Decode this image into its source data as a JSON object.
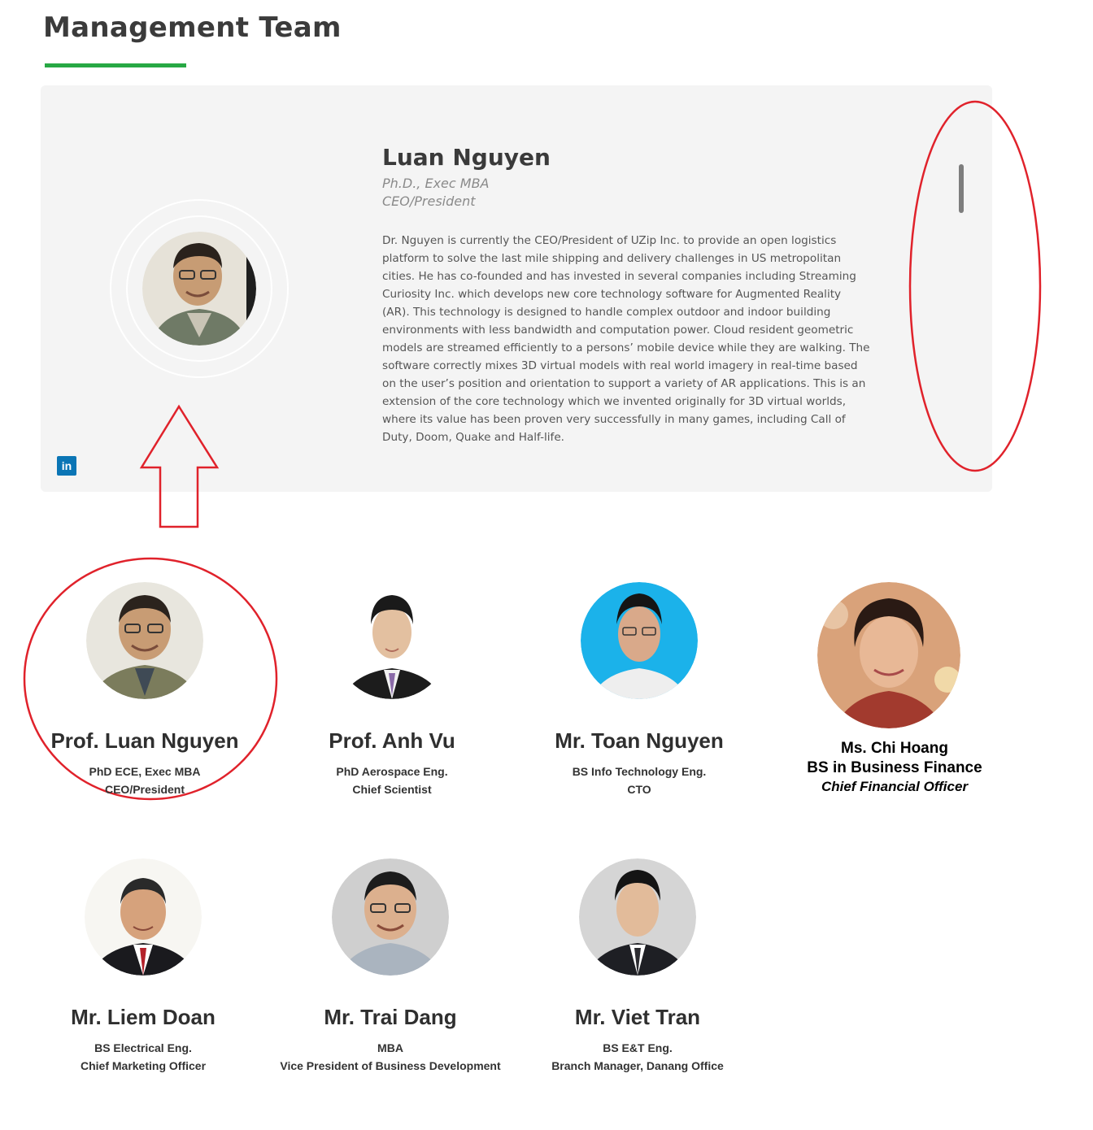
{
  "page": {
    "title": "Management Team",
    "accent_color": "#27a844"
  },
  "featured": {
    "name": "Luan Nguyen",
    "degree": "Ph.D., Exec MBA",
    "role": "CEO/President",
    "bio": "Dr. Nguyen is currently the CEO/President of UZip Inc. to provide an open logistics platform to solve the last mile shipping and delivery challenges in US metropolitan cities. He has co-founded and has invested in several companies including Streaming Curiosity Inc. which develops new core technology software for Augmented Reality (AR). This technology is designed to handle complex outdoor and indoor building environments with less bandwidth and computation power. Cloud resident geometric models are streamed efficiently to a persons’ mobile device while they are walking. The software correctly mixes 3D virtual models with real world imagery in real-time based on the user’s position and orientation to support a variety of AR applications. This is an extension of the core technology which we invented originally for 3D virtual worlds, where its value has been proven very successfully in many games, including Call of Duty, Doom, Quake and Half-life.",
    "social_icon": "linkedin-icon",
    "social_label": "in"
  },
  "team": [
    {
      "name": "Prof. Luan Nguyen",
      "degree": "PhD ECE, Exec MBA",
      "role": "CEO/President"
    },
    {
      "name": "Prof. Anh Vu",
      "degree": "PhD Aerospace Eng.",
      "role": "Chief Scientist"
    },
    {
      "name": "Mr. Toan Nguyen",
      "degree": "BS Info Technology Eng.",
      "role": "CTO"
    },
    {
      "name": "Ms. Chi Hoang",
      "degree": "BS in Business Finance",
      "role": "Chief Financial Officer"
    },
    {
      "name": "Mr. Liem Doan",
      "degree": "BS Electrical Eng.",
      "role": "Chief Marketing Officer"
    },
    {
      "name": "Mr. Trai Dang",
      "degree": "MBA",
      "role": "Vice President of Business Development"
    },
    {
      "name": "Mr. Viet Tran",
      "degree": "BS E&T Eng.",
      "role": "Branch Manager, Danang Office"
    }
  ],
  "annotations": {
    "color": "#e0222b"
  }
}
